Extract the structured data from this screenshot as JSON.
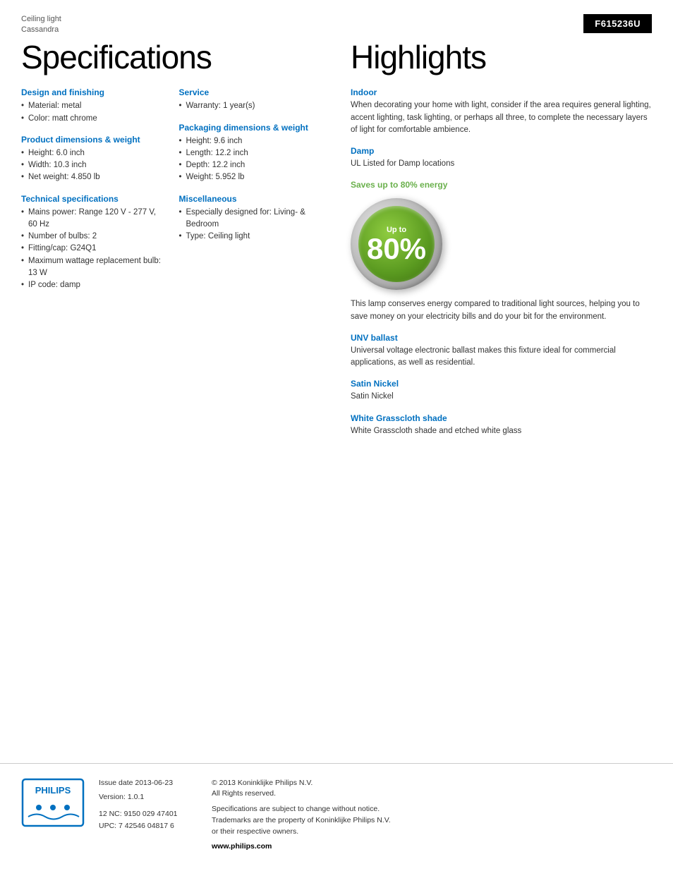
{
  "product": {
    "type": "Ceiling light",
    "name": "Cassandra",
    "model": "F615236U"
  },
  "page_title": "Specifications",
  "highlights_title": "Highlights",
  "specs": {
    "design_finishing": {
      "title": "Design and finishing",
      "items": [
        "Material: metal",
        "Color: matt chrome"
      ]
    },
    "product_dimensions": {
      "title": "Product dimensions & weight",
      "items": [
        "Height: 6.0 inch",
        "Width: 10.3 inch",
        "Net weight: 4.850 lb"
      ]
    },
    "technical": {
      "title": "Technical specifications",
      "items": [
        "Mains power: Range 120 V - 277 V, 60 Hz",
        "Number of bulbs: 2",
        "Fitting/cap: G24Q1",
        "Maximum wattage replacement bulb: 13 W",
        "IP code: damp"
      ]
    },
    "service": {
      "title": "Service",
      "items": [
        "Warranty: 1 year(s)"
      ]
    },
    "packaging": {
      "title": "Packaging dimensions & weight",
      "items": [
        "Height: 9.6 inch",
        "Length: 12.2 inch",
        "Depth: 12.2 inch",
        "Weight: 5.952 lb"
      ]
    },
    "miscellaneous": {
      "title": "Miscellaneous",
      "items": [
        "Especially designed for: Living- & Bedroom",
        "Type: Ceiling light"
      ]
    }
  },
  "highlights": {
    "indoor": {
      "title": "Indoor",
      "text": "When decorating your home with light, consider if the area requires general lighting, accent lighting, task lighting, or perhaps all three, to complete the necessary layers of light for comfortable ambience."
    },
    "damp": {
      "title": "Damp",
      "text": "UL Listed for Damp locations"
    },
    "energy": {
      "title": "Saves up to 80% energy",
      "badge_up_to": "Up to",
      "badge_percent": "80%",
      "text": "This lamp conserves energy compared to traditional light sources, helping you to save money on your electricity bills and do your bit for the environment."
    },
    "unv_ballast": {
      "title": "UNV ballast",
      "text": "Universal voltage electronic ballast makes this fixture ideal for commercial applications, as well as residential."
    },
    "satin_nickel": {
      "title": "Satin Nickel",
      "text": "Satin Nickel"
    },
    "grasscloth": {
      "title": "White Grasscloth shade",
      "text": "White Grasscloth shade and etched white glass"
    }
  },
  "footer": {
    "issue_date_label": "Issue date 2013-06-23",
    "version_label": "Version: 1.0.1",
    "nc_upc": "12 NC: 9150 029 47401\nUPC: 7 42546 04817 6",
    "copyright": "© 2013 Koninklijke Philips N.V.\nAll Rights reserved.",
    "disclaimer": "Specifications are subject to change without notice.\nTrademarks are the property of Koninklijke Philips N.V.\nor their respective owners.",
    "website": "www.philips.com"
  }
}
